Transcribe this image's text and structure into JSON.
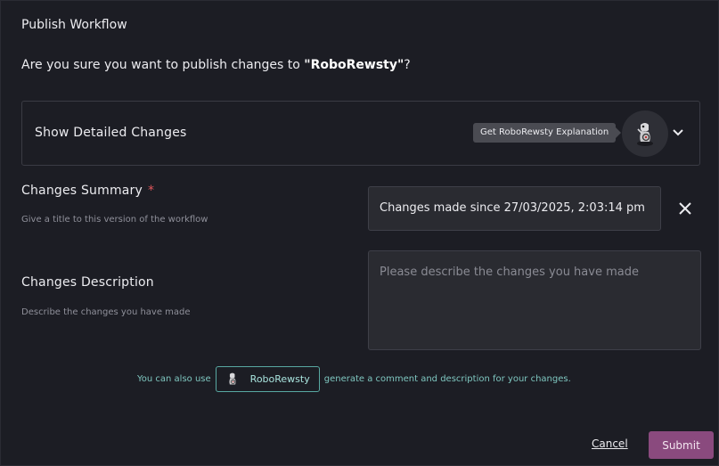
{
  "dialog": {
    "title": "Publish Workflow",
    "question_prefix": "Are you sure you want to publish changes to ",
    "workflow_name": "\"RoboRewsty\"",
    "question_suffix": "?"
  },
  "details": {
    "label": "Show Detailed Changes",
    "tooltip": "Get RoboRewsty Explanation",
    "avatar_icon": "robot-mascot-icon",
    "toggle_icon": "chevron-down-icon"
  },
  "summary": {
    "label": "Changes Summary",
    "required_mark": "*",
    "hint": "Give a title to this version of the workflow",
    "value": "Changes made since 27/03/2025, 2:03:14 pm",
    "clear_icon": "close-icon"
  },
  "description": {
    "label": "Changes Description",
    "hint": "Describe the changes you have made",
    "placeholder": "Please describe the changes you have made",
    "value": ""
  },
  "ai_hint": {
    "prefix": "You can also use",
    "chip_label": "RoboRewsty",
    "suffix": "generate a comment and description for your changes."
  },
  "actions": {
    "cancel_label": "Cancel",
    "submit_label": "Submit"
  },
  "colors": {
    "background": "#1c1d24",
    "submit": "#8a4a7e",
    "accent_teal": "#7fc7c0",
    "required": "#e0565b"
  }
}
